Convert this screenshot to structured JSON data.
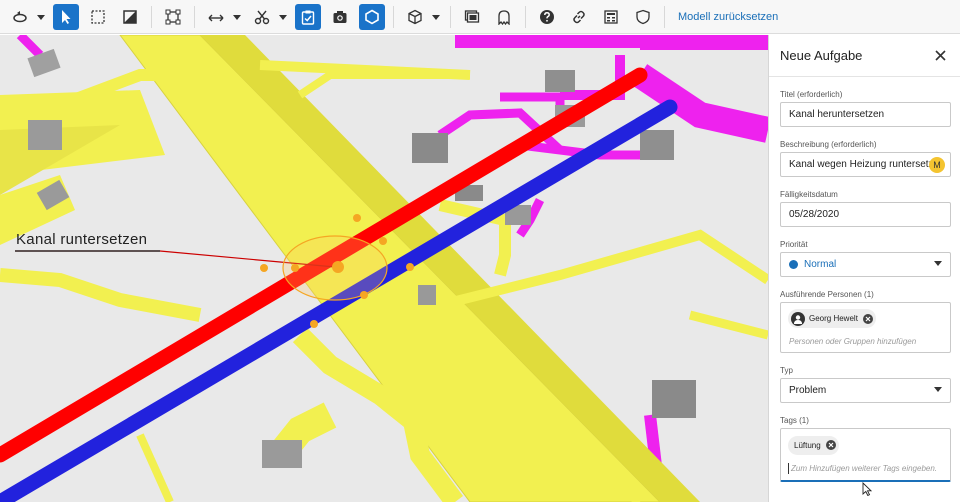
{
  "toolbar": {
    "reset_label": "Modell zurücksetzen",
    "icons": [
      "orbit-icon",
      "select-arrow-icon",
      "box-select-icon",
      "section-icon",
      "frame-icon",
      "measure-icon",
      "cut-icon",
      "task-icon",
      "camera-icon",
      "polygon-icon",
      "cube-icon",
      "layers-icon",
      "ghost-icon",
      "help-icon",
      "link-icon",
      "properties-icon",
      "shield-icon"
    ],
    "accent_color": "#1a73c9"
  },
  "viewport": {
    "annotation_label": "Kanal runtersetzen",
    "colors": {
      "duct": "#f2f050",
      "red_pipe": "#ff0000",
      "blue_pipe": "#2222dd",
      "magenta_pipe": "#ee22ee",
      "background": "#e9e9e9"
    }
  },
  "panel": {
    "title": "Neue Aufgabe",
    "title_label": "Titel (erforderlich)",
    "title_value": "Kanal heruntersetzen",
    "description_label": "Beschreibung (erforderlich)",
    "description_value": "Kanal wegen Heizung runtersetzen",
    "mention_avatar": "M",
    "due_label": "Fälligkeitsdatum",
    "due_value": "05/28/2020",
    "priority_label": "Priorität",
    "priority_value": "Normal",
    "priority_color": "#1a6fb8",
    "assignees_label": "Ausführende Personen (1)",
    "assignee_name": "Georg Hewelt",
    "assignees_placeholder": "Personen oder Gruppen hinzufügen",
    "type_label": "Typ",
    "type_value": "Problem",
    "tags_label": "Tags (1)",
    "tag_name": "Lüftung",
    "tags_placeholder": "Zum Hinzufügen weiterer Tags eingeben."
  }
}
